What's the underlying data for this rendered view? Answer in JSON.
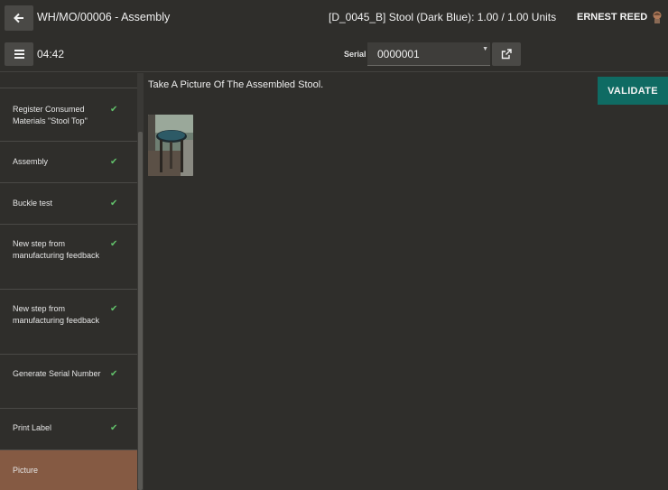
{
  "header": {
    "title": "WH/MO/00006 - Assembly",
    "product": "[D_0045_B] Stool (Dark Blue): 1.00 / 1.00 Units",
    "user": "ERNEST REED",
    "timer": "04:42",
    "serial_label": "Serial",
    "serial_value": "0000001"
  },
  "steps": [
    {
      "label": "Register Consumed Materials \"Stool Top\"",
      "done": true
    },
    {
      "label": "Assembly",
      "done": true
    },
    {
      "label": "Buckle test",
      "done": true
    },
    {
      "label": "New step from manufacturing feedback",
      "done": true
    },
    {
      "label": "New step from manufacturing feedback",
      "done": true
    },
    {
      "label": "Generate Serial Number",
      "done": true
    },
    {
      "label": "Print Label",
      "done": true
    },
    {
      "label": "Picture",
      "done": false,
      "active": true
    }
  ],
  "main": {
    "instruction": "Take A Picture Of The Assembled Stool.",
    "validate_label": "VALIDATE"
  },
  "colors": {
    "background": "#2f2e2b",
    "active_step": "#855a43",
    "validate": "#0f6b63",
    "check": "#62c26b"
  },
  "icons": {
    "back": "arrow-left-icon",
    "menu": "hamburger-icon",
    "external": "external-link-icon",
    "check": "check-icon",
    "avatar": "user-avatar"
  }
}
